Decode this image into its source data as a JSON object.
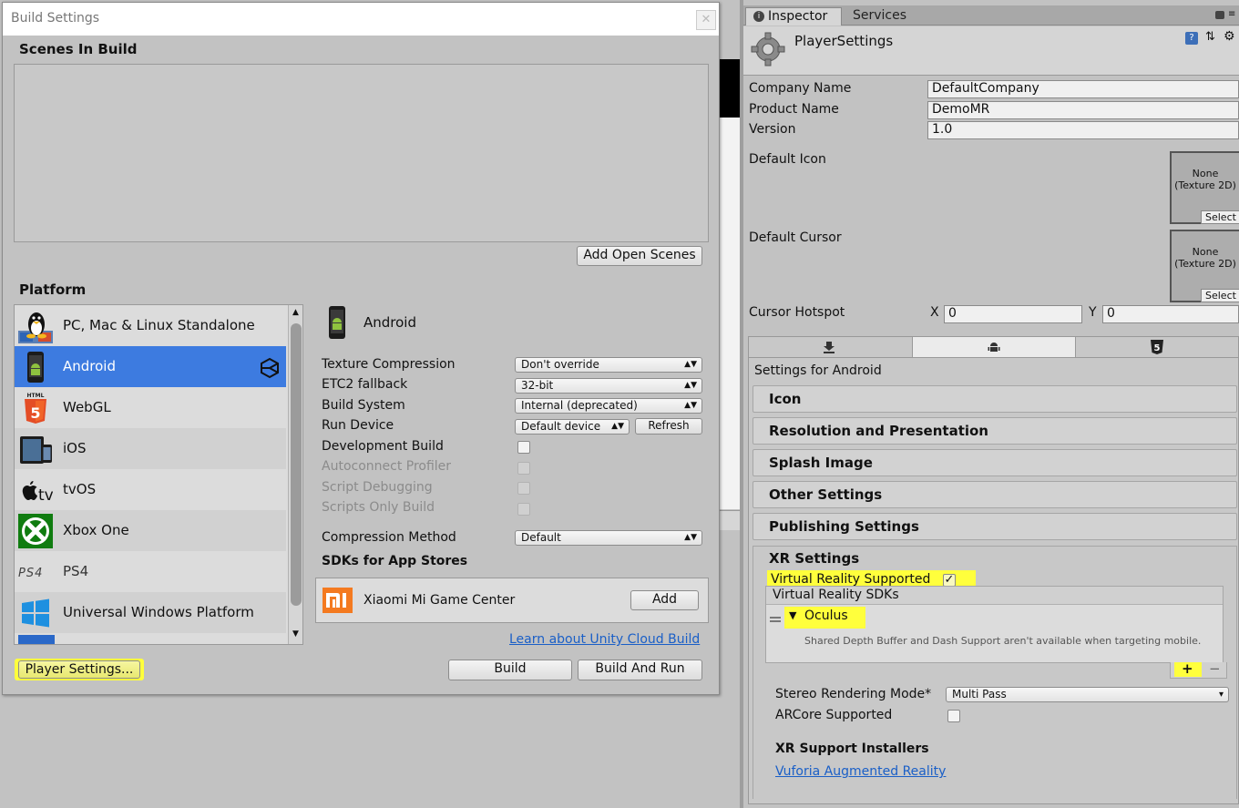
{
  "build_window": {
    "title": "Build Settings",
    "close_glyph": "✕",
    "scenes_title": "Scenes In Build",
    "add_open_scenes": "Add Open Scenes",
    "platform_title": "Platform",
    "platforms": [
      {
        "label": "PC, Mac & Linux Standalone",
        "icon": "linux-tux-icon"
      },
      {
        "label": "Android",
        "icon": "android-phone-icon",
        "selected": true
      },
      {
        "label": "WebGL",
        "icon": "html5-icon"
      },
      {
        "label": "iOS",
        "icon": "ios-devices-icon"
      },
      {
        "label": "tvOS",
        "icon": "apple-tv-icon"
      },
      {
        "label": "Xbox One",
        "icon": "xbox-icon"
      },
      {
        "label": "PS4",
        "icon": "ps4-icon"
      },
      {
        "label": "Universal Windows Platform",
        "icon": "windows-icon"
      }
    ],
    "selected_platform": "Android",
    "settings": {
      "texture_compression": {
        "label": "Texture Compression",
        "value": "Don't override"
      },
      "etc2_fallback": {
        "label": "ETC2 fallback",
        "value": "32-bit"
      },
      "build_system": {
        "label": "Build System",
        "value": "Internal (deprecated)"
      },
      "run_device": {
        "label": "Run Device",
        "value": "Default device",
        "refresh": "Refresh"
      },
      "development_build": {
        "label": "Development Build"
      },
      "autoconnect_profiler": {
        "label": "Autoconnect Profiler"
      },
      "script_debugging": {
        "label": "Script Debugging"
      },
      "scripts_only_build": {
        "label": "Scripts Only Build"
      },
      "compression_method": {
        "label": "Compression Method",
        "value": "Default"
      }
    },
    "sdks_title": "SDKs for App Stores",
    "sdk_name": "Xiaomi Mi Game Center",
    "sdk_add": "Add",
    "cloud_link": "Learn about Unity Cloud Build",
    "build": "Build",
    "build_and_run": "Build And Run",
    "player_settings": "Player Settings..."
  },
  "inspector": {
    "tabs": {
      "inspector": "Inspector",
      "services": "Services"
    },
    "object_name": "PlayerSettings",
    "company_name": {
      "label": "Company Name",
      "value": "DefaultCompany"
    },
    "product_name": {
      "label": "Product Name",
      "value": "DemoMR"
    },
    "version": {
      "label": "Version",
      "value": "1.0"
    },
    "default_icon": {
      "label": "Default Icon",
      "slot_text": "None\n(Texture 2D)",
      "select": "Select"
    },
    "default_cursor": {
      "label": "Default Cursor",
      "slot_text": "None\n(Texture 2D)",
      "select": "Select"
    },
    "cursor_hotspot": {
      "label": "Cursor Hotspot",
      "x_label": "X",
      "x_value": "0",
      "y_label": "Y",
      "y_value": "0"
    },
    "settings_for": "Settings for Android",
    "sections": [
      "Icon",
      "Resolution and Presentation",
      "Splash Image",
      "Other Settings",
      "Publishing Settings"
    ],
    "xr": {
      "title": "XR Settings",
      "vr_supported": "Virtual Reality Supported",
      "vr_sdks_header": "Virtual Reality SDKs",
      "sdk_item": "Oculus",
      "sdk_note": "Shared Depth Buffer and Dash Support aren't available when targeting mobile.",
      "plus": "+",
      "minus": "−",
      "stereo_label": "Stereo Rendering Mode*",
      "stereo_value": "Multi Pass",
      "arcore_label": "ARCore Supported",
      "installers_title": "XR Support Installers",
      "vuforia_link": "Vuforia Augmented Reality"
    }
  }
}
